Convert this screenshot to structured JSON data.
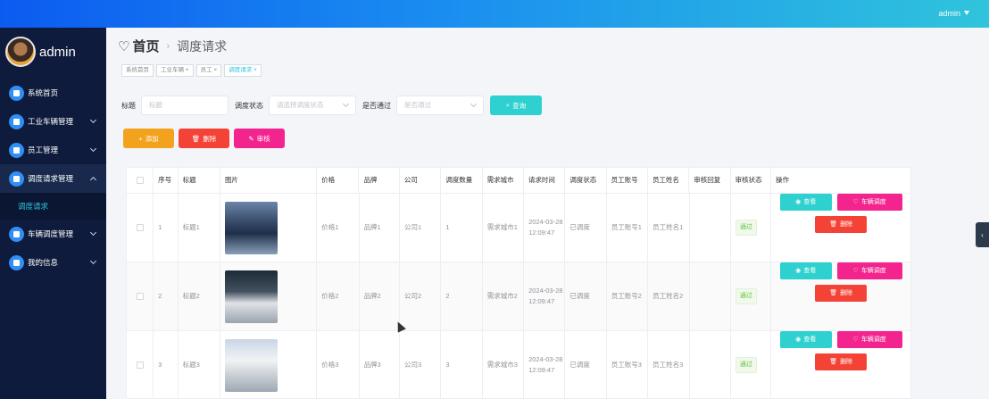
{
  "topbar": {
    "user": "admin"
  },
  "sidebar": {
    "brand": "admin",
    "items": [
      {
        "label": "系统首页",
        "icon": "home-icon"
      },
      {
        "label": "工业车辆管理",
        "icon": "chat-icon"
      },
      {
        "label": "员工管理",
        "icon": "grid-icon"
      },
      {
        "label": "调度请求管理",
        "icon": "cloud-icon",
        "sub": [
          "调度请求"
        ]
      },
      {
        "label": "车辆调度管理",
        "icon": "grid-icon"
      },
      {
        "label": "我的信息",
        "icon": "window-icon"
      }
    ]
  },
  "header": {
    "home": "首页",
    "page": "调度请求"
  },
  "tags": [
    "系统首页",
    "工业车辆 ×",
    "员工 ×",
    "调度请求 ×"
  ],
  "filters": {
    "title_label": "标题",
    "title_placeholder": "标题",
    "status_label": "调度状态",
    "status_placeholder": "请选择调度状态",
    "pass_label": "是否通过",
    "pass_placeholder": "是否通过",
    "search": "查询"
  },
  "actions": {
    "add": "添加",
    "delete": "删除",
    "audit": "审核"
  },
  "table": {
    "headers": [
      "序号",
      "标题",
      "图片",
      "价格",
      "品牌",
      "公司",
      "调度数量",
      "需求城市",
      "请求时间",
      "调度状态",
      "员工账号",
      "员工姓名",
      "审核回复",
      "审核状态",
      "操作"
    ],
    "rows": [
      {
        "no": "1",
        "title": "标题1",
        "price": "价格1",
        "brand": "品牌1",
        "company": "公司1",
        "qty": "1",
        "city": "需求城市1",
        "time": "2024-03-28 12:09:47",
        "status": "已调度",
        "emp_no": "员工账号1",
        "emp_name": "员工姓名1",
        "reply": "",
        "audit": "通过"
      },
      {
        "no": "2",
        "title": "标题2",
        "price": "价格2",
        "brand": "品牌2",
        "company": "公司2",
        "qty": "2",
        "city": "需求城市2",
        "time": "2024-03-28 12:09:47",
        "status": "已调度",
        "emp_no": "员工账号2",
        "emp_name": "员工姓名2",
        "reply": "",
        "audit": "通过"
      },
      {
        "no": "3",
        "title": "标题3",
        "price": "价格3",
        "brand": "品牌3",
        "company": "公司3",
        "qty": "3",
        "city": "需求城市3",
        "time": "2024-03-28 12:09:47",
        "status": "已调度",
        "emp_no": "员工账号3",
        "emp_name": "员工姓名3",
        "reply": "",
        "audit": "通过"
      }
    ],
    "ops": {
      "view": "查看",
      "dispatch": "车辆调度",
      "delete": "删除"
    }
  },
  "colors": {
    "accent": "#2ed1cf",
    "danger": "#f44336",
    "warning": "#f3a21d",
    "pink": "#f3248d",
    "sidebar": "#0e1b3c"
  }
}
